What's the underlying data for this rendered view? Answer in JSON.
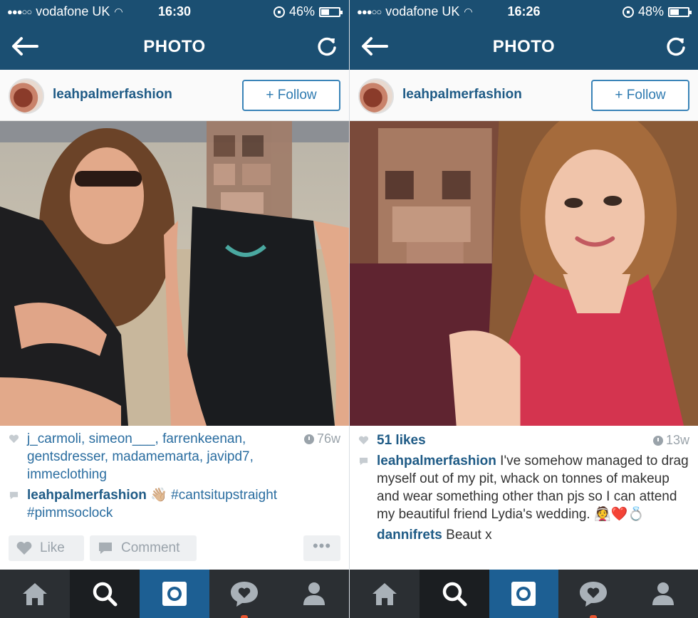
{
  "screens": [
    {
      "status": {
        "carrier": "vodafone UK",
        "time": "16:30",
        "battery": "46%",
        "battery_level": 0.46
      },
      "nav": {
        "title": "PHOTO"
      },
      "user": {
        "username": "leahpalmerfashion",
        "follow_label": "+ Follow"
      },
      "likes_line": {
        "text": "j_carmoli, simeon___, farrenkeenan, gentsdresser, madamemarta, javipd7, immeclothing",
        "age": "76w"
      },
      "caption": {
        "user": "leahpalmerfashion",
        "emoji": "👋🏼",
        "text": "#cantsitupstraight #pimmsoclock"
      },
      "actions": {
        "like": "Like",
        "comment": "Comment",
        "more": "•••"
      }
    },
    {
      "status": {
        "carrier": "vodafone UK",
        "time": "16:26",
        "battery": "48%",
        "battery_level": 0.48
      },
      "nav": {
        "title": "PHOTO"
      },
      "user": {
        "username": "leahpalmerfashion",
        "follow_label": "+ Follow"
      },
      "likes_line": {
        "text": "51 likes",
        "age": "13w"
      },
      "caption": {
        "user": "leahpalmerfashion",
        "text": "I've somehow managed to drag myself out of my pit, whack on tonnes of makeup and wear something other than pjs so I can attend my beautiful friend Lydia's wedding.",
        "emoji": "👰❤️💍"
      },
      "comment": {
        "user": "dannifrets",
        "text": "Beaut x"
      }
    }
  ],
  "tabs": [
    "home-icon",
    "search-icon",
    "camera-icon",
    "activity-icon",
    "profile-icon"
  ],
  "colors": {
    "header": "#1b4f72",
    "link": "#1f5b86",
    "tabbar": "#2b2f33",
    "camera_tab": "#1d5f93"
  }
}
